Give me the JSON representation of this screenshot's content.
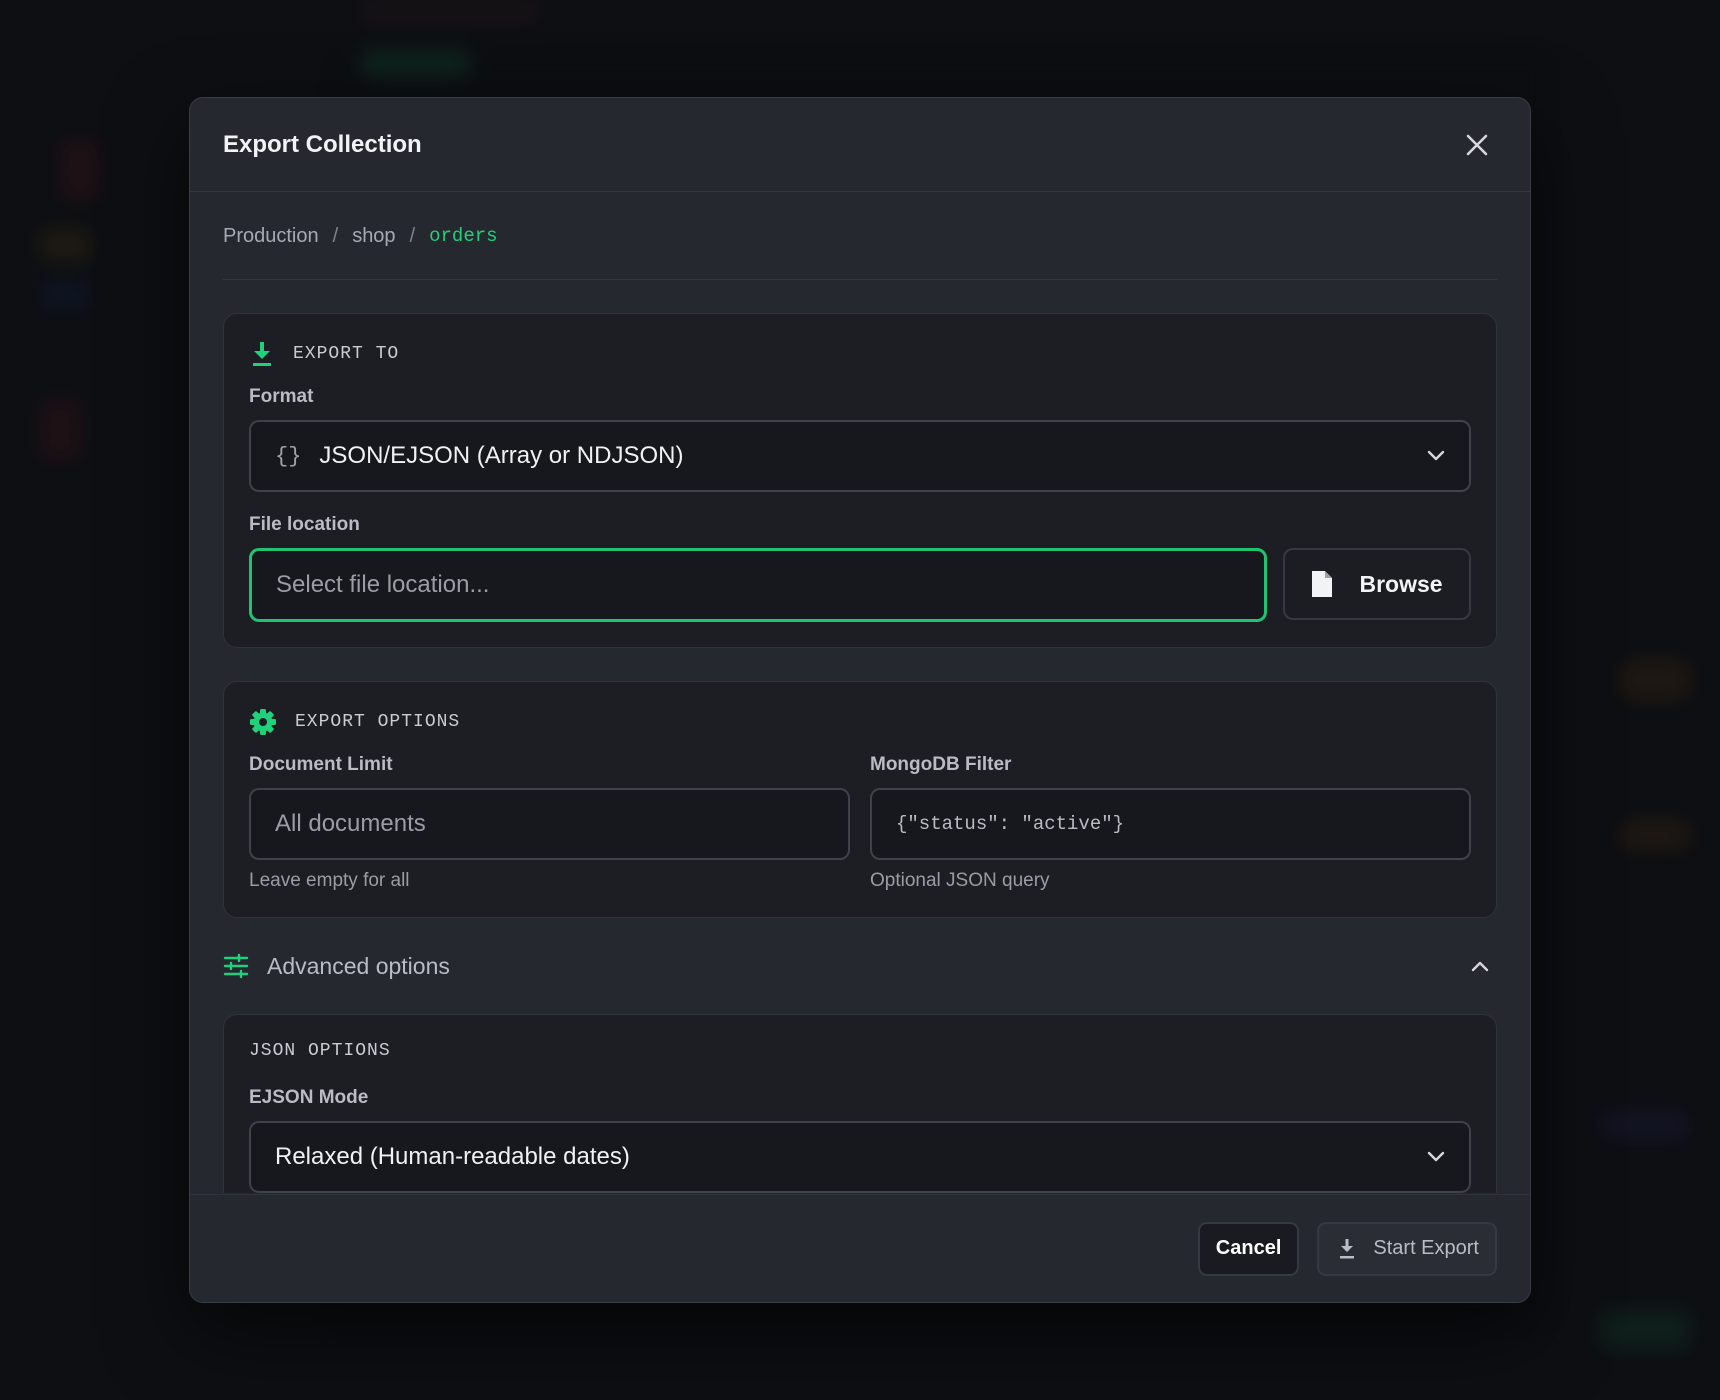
{
  "modal": {
    "title": "Export Collection"
  },
  "breadcrumb": {
    "connection": "Production",
    "database": "shop",
    "collection": "orders",
    "separator": "/"
  },
  "export_to": {
    "heading": "EXPORT TO",
    "icon": "download-icon",
    "format_label": "Format",
    "format_value": "JSON/EJSON (Array or NDJSON)",
    "format_icon_glyph": "{}",
    "file_location_label": "File location",
    "file_location_placeholder": "Select file location...",
    "browse_label": "Browse"
  },
  "export_options": {
    "heading": "EXPORT OPTIONS",
    "icon": "gear-icon",
    "document_limit_label": "Document Limit",
    "document_limit_placeholder": "All documents",
    "document_limit_hint": "Leave empty for all",
    "filter_label": "MongoDB Filter",
    "filter_placeholder": "{\"status\": \"active\"}",
    "filter_hint": "Optional JSON query"
  },
  "advanced": {
    "label": "Advanced options",
    "expanded": true,
    "json_options_heading": "JSON OPTIONS",
    "ejson_mode_label": "EJSON Mode",
    "ejson_mode_value": "Relaxed (Human-readable dates)"
  },
  "footer": {
    "cancel_label": "Cancel",
    "start_label": "Start Export"
  },
  "colors": {
    "accent": "#1fd17a",
    "focus_border": "#1fc372",
    "modal_bg": "#262830",
    "section_bg": "#1d1e24"
  }
}
